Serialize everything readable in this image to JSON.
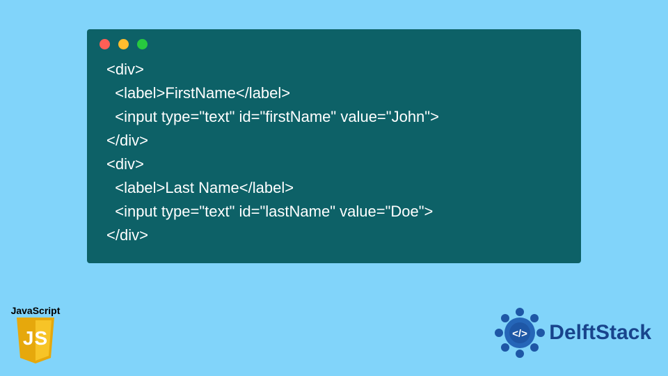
{
  "code": {
    "lines": [
      "<div>",
      "  <label>FirstName</label>",
      "  <input type=\"text\" id=\"firstName\" value=\"John\">",
      "</div>",
      "<div>",
      "  <label>Last Name</label>",
      "  <input type=\"text\" id=\"lastName\" value=\"Doe\">",
      "</div>"
    ]
  },
  "js_badge": {
    "label": "JavaScript",
    "letters": "JS"
  },
  "delft": {
    "brand": "DelftStack"
  }
}
